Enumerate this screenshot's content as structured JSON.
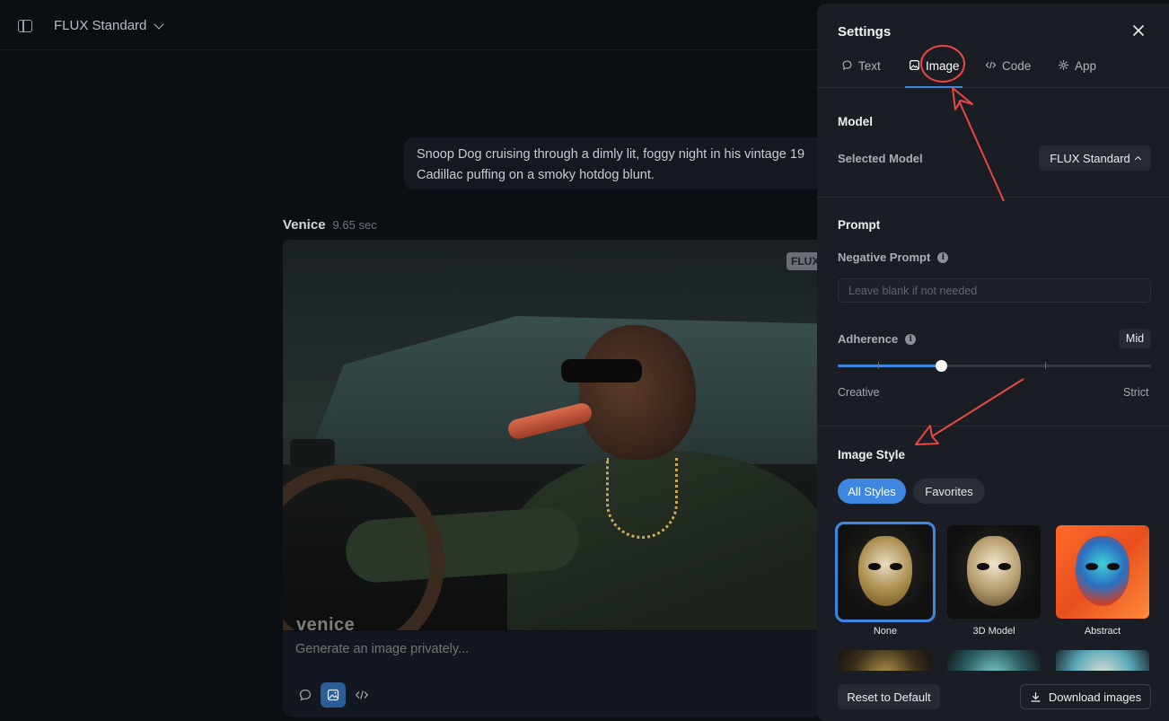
{
  "topbar": {
    "model_name": "FLUX Standard"
  },
  "chat": {
    "user_message": "Snoop Dog cruising through a dimly lit, foggy night in his vintage 19\nCadillac puffing on a smoky hotdog blunt.",
    "bot_name": "Venice",
    "response_time": "9.65 sec",
    "image_badge": "FLUX",
    "image_watermark": "venice",
    "composer_placeholder": "Generate an image privately..."
  },
  "settings": {
    "title": "Settings",
    "tabs": [
      {
        "label": "Text",
        "icon": "chat-bubble-icon"
      },
      {
        "label": "Image",
        "icon": "image-icon",
        "active": true
      },
      {
        "label": "Code",
        "icon": "code-icon"
      },
      {
        "label": "App",
        "icon": "gear-icon"
      }
    ],
    "model": {
      "section_title": "Model",
      "selected_label": "Selected Model",
      "selected_value": "FLUX Standard"
    },
    "prompt": {
      "section_title": "Prompt",
      "negative_label": "Negative Prompt",
      "negative_placeholder": "Leave blank if not needed",
      "adherence_label": "Adherence",
      "adherence_value": "Mid",
      "adherence_level": 0.33,
      "slider_min_label": "Creative",
      "slider_max_label": "Strict"
    },
    "image_style": {
      "section_title": "Image Style",
      "filters": [
        "All Styles",
        "Favorites"
      ],
      "styles": [
        {
          "name": "None",
          "selected": true
        },
        {
          "name": "3D Model"
        },
        {
          "name": "Abstract"
        }
      ]
    },
    "footer": {
      "reset_label": "Reset to Default",
      "download_label": "Download images"
    }
  },
  "colors": {
    "accent": "#3f86e0",
    "annotation": "#e8483f",
    "panel_bg": "#1a1e24",
    "page_bg": "#0b0e12"
  }
}
